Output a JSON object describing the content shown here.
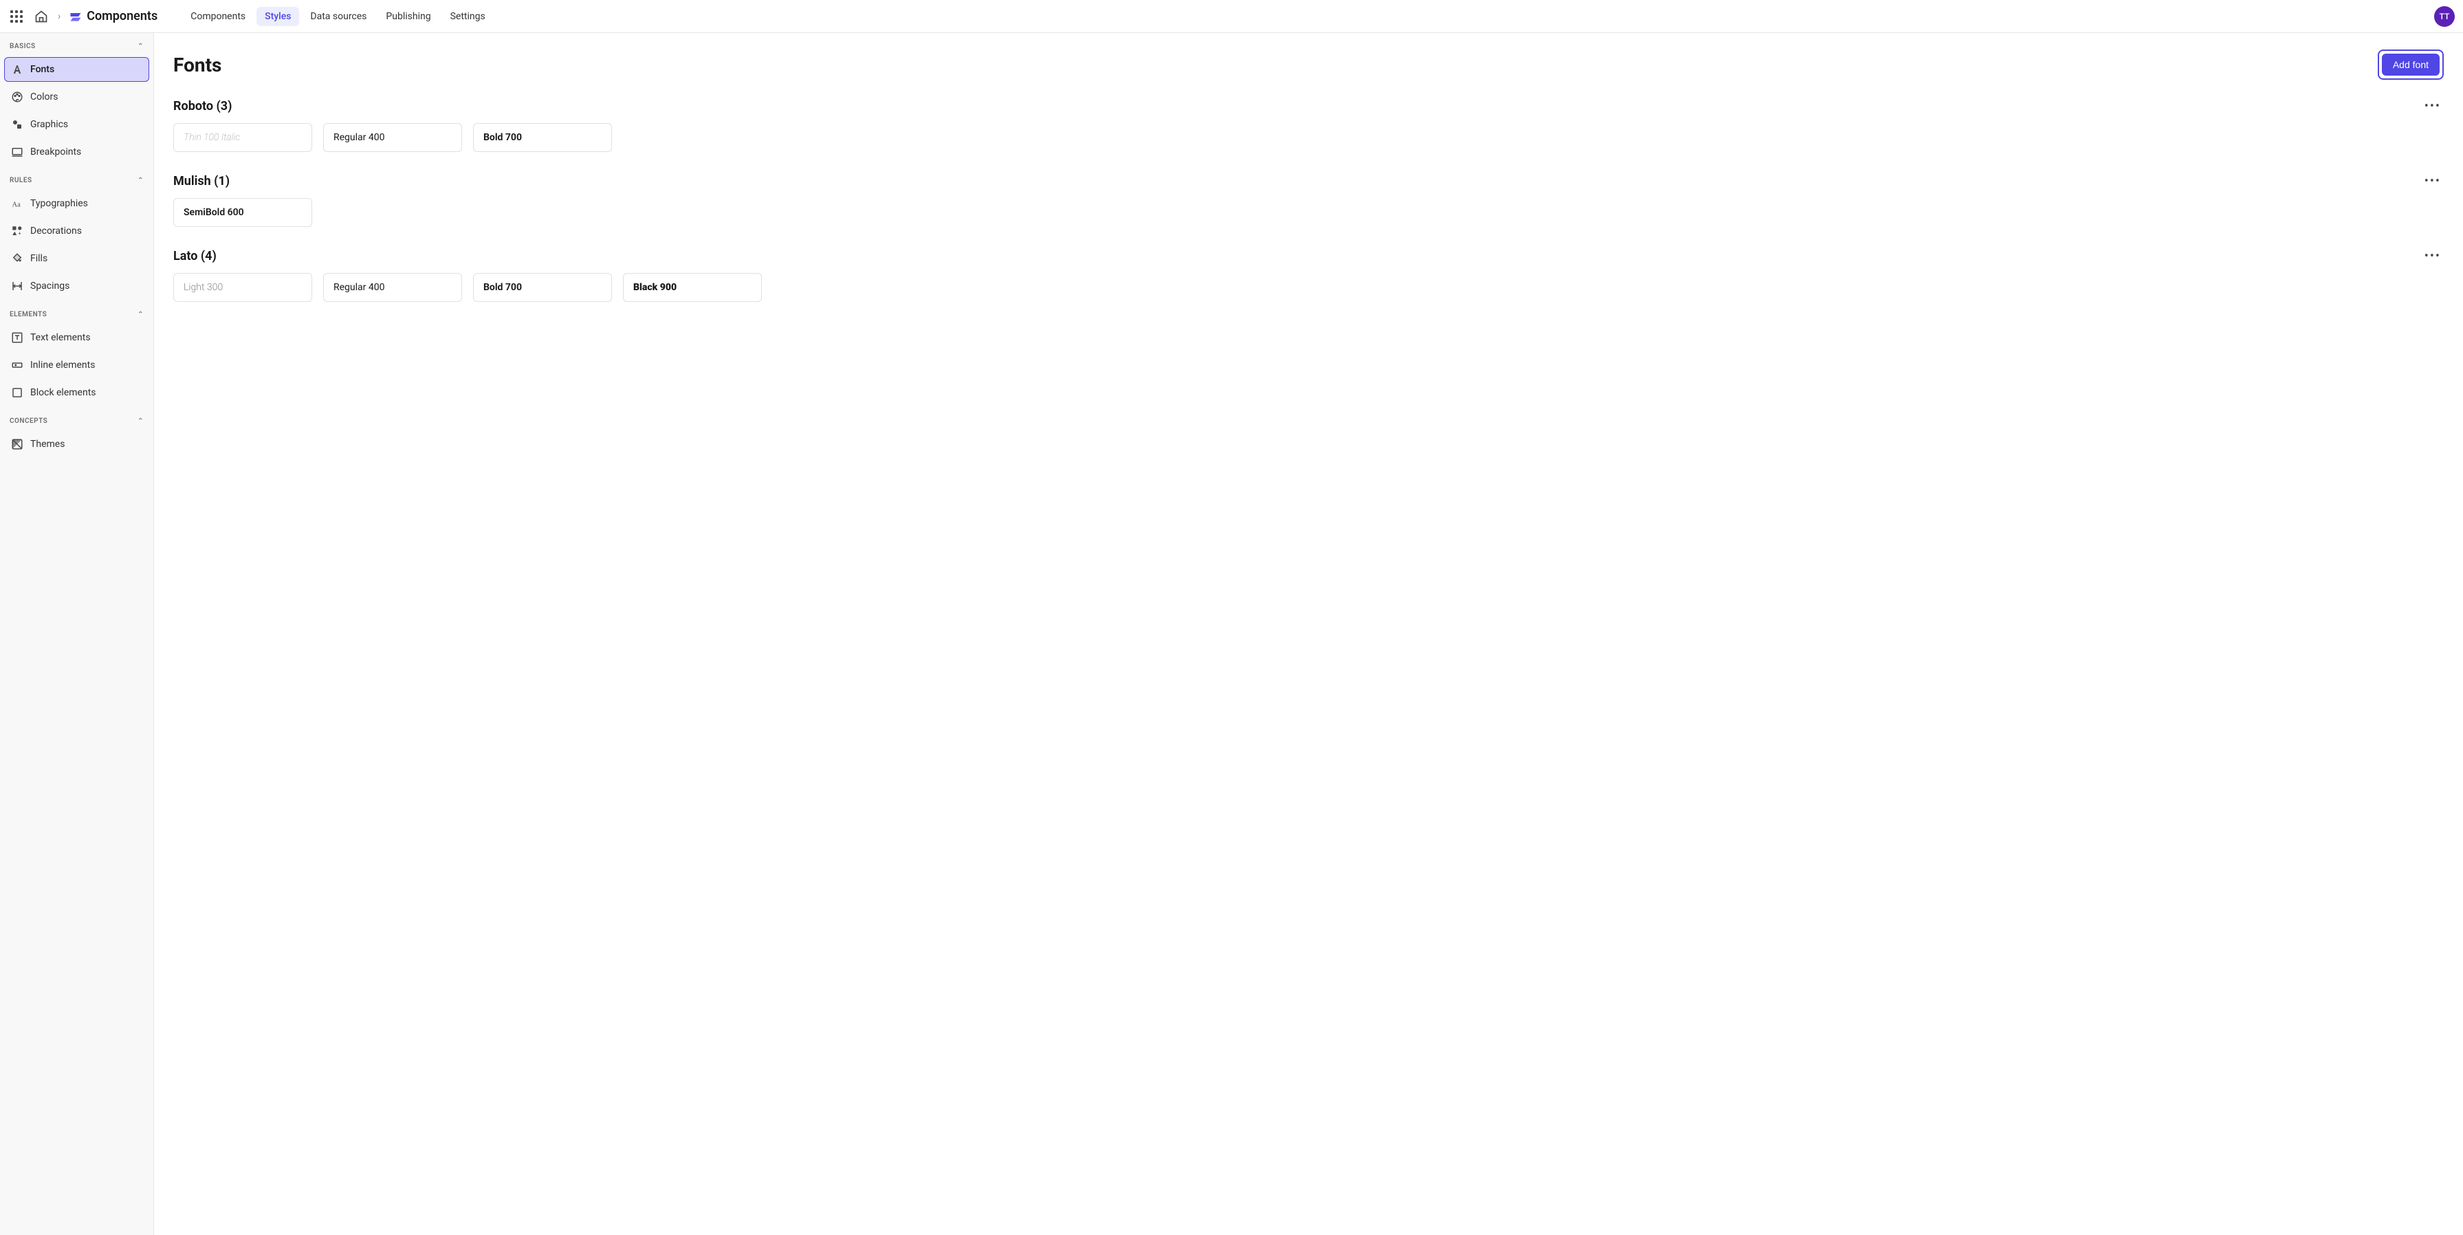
{
  "header": {
    "brand": "Components",
    "tabs": [
      "Components",
      "Styles",
      "Data sources",
      "Publishing",
      "Settings"
    ],
    "active_tab_index": 1,
    "avatar_initials": "TT"
  },
  "sidebar": {
    "sections": [
      {
        "title": "Basics",
        "items": [
          {
            "label": "Fonts",
            "icon": "fonts-icon",
            "active": true
          },
          {
            "label": "Colors",
            "icon": "palette-icon"
          },
          {
            "label": "Graphics",
            "icon": "graphics-icon"
          },
          {
            "label": "Breakpoints",
            "icon": "device-icon"
          }
        ]
      },
      {
        "title": "Rules",
        "items": [
          {
            "label": "Typographies",
            "icon": "typography-icon"
          },
          {
            "label": "Decorations",
            "icon": "decorations-icon"
          },
          {
            "label": "Fills",
            "icon": "fill-icon"
          },
          {
            "label": "Spacings",
            "icon": "spacing-icon"
          }
        ]
      },
      {
        "title": "Elements",
        "items": [
          {
            "label": "Text elements",
            "icon": "text-element-icon"
          },
          {
            "label": "Inline elements",
            "icon": "inline-element-icon"
          },
          {
            "label": "Block elements",
            "icon": "block-element-icon"
          }
        ]
      },
      {
        "title": "Concepts",
        "items": [
          {
            "label": "Themes",
            "icon": "themes-icon"
          }
        ]
      }
    ]
  },
  "main": {
    "title": "Fonts",
    "add_button_label": "Add font",
    "font_groups": [
      {
        "name": "Roboto",
        "count": 3,
        "variants": [
          {
            "label": "Thin 100 Italic",
            "weight_class": "w100"
          },
          {
            "label": "Regular 400",
            "weight_class": "w400"
          },
          {
            "label": "Bold 700",
            "weight_class": "w700"
          }
        ]
      },
      {
        "name": "Mulish",
        "count": 1,
        "variants": [
          {
            "label": "SemiBold 600",
            "weight_class": "w600"
          }
        ]
      },
      {
        "name": "Lato",
        "count": 4,
        "variants": [
          {
            "label": "Light 300",
            "weight_class": "w300"
          },
          {
            "label": "Regular 400",
            "weight_class": "w400"
          },
          {
            "label": "Bold 700",
            "weight_class": "w700"
          },
          {
            "label": "Black 900",
            "weight_class": "w900"
          }
        ]
      }
    ]
  }
}
